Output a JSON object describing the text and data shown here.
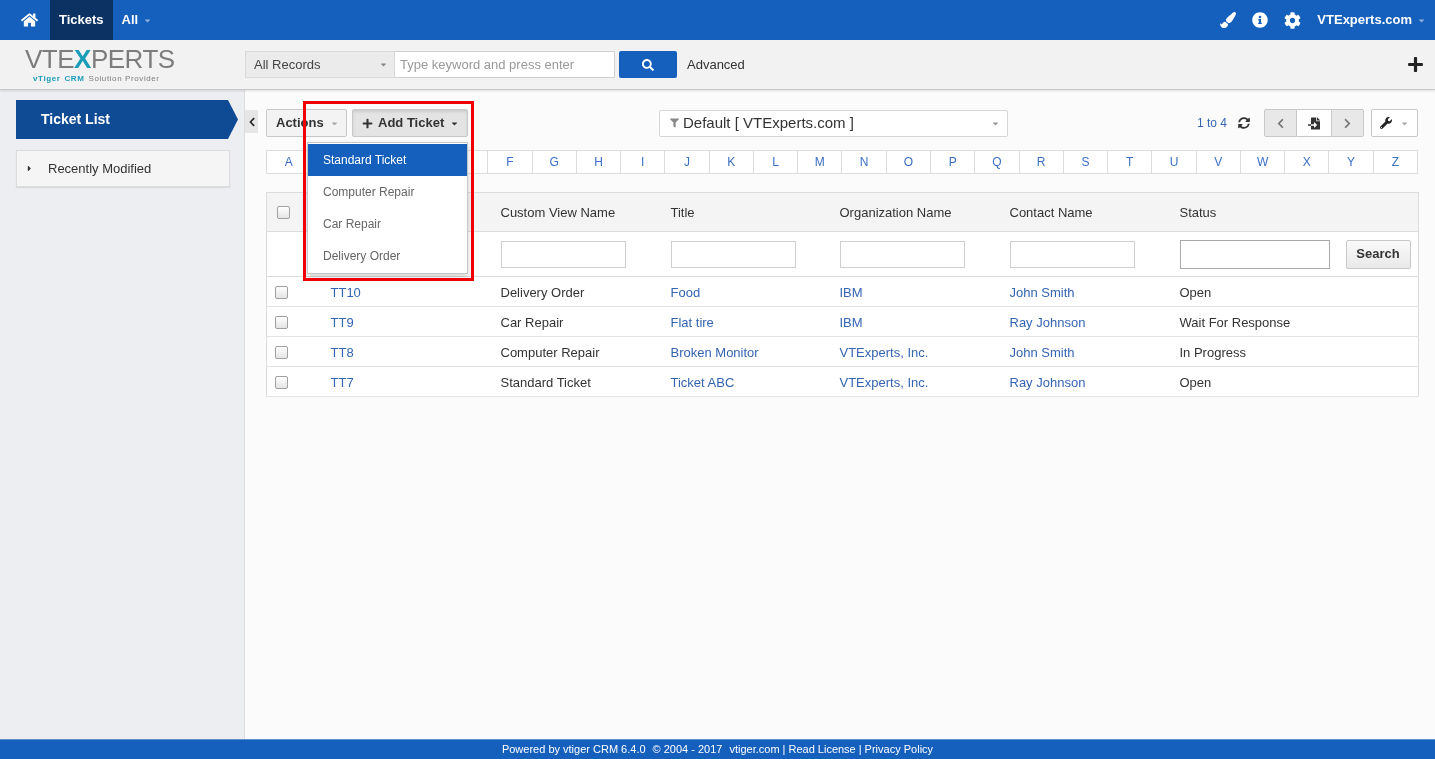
{
  "top_nav": {
    "tabs": [
      {
        "label": "Tickets",
        "kind": "module",
        "selected": true
      },
      {
        "label": "All",
        "kind": "menu",
        "selected": false
      }
    ],
    "user_menu": {
      "label": "VTExperts.com"
    }
  },
  "header": {
    "logo": {
      "wordmark": [
        {
          "text": "VTE",
          "color": "#7d7d7d"
        },
        {
          "text": "X",
          "color": "#1b9cb8"
        },
        {
          "text": "PERTS",
          "color": "#7d7d7d"
        }
      ],
      "tagline": [
        {
          "text": "vTiger",
          "accent": true
        },
        {
          "text": "CRM",
          "accent": true
        },
        {
          "text": "Solution Provider",
          "accent": false
        }
      ]
    },
    "search": {
      "scope": "All Records",
      "placeholder": "Type keyword and press enter"
    },
    "advanced_link": "Advanced"
  },
  "sidebar": {
    "title": "Ticket List",
    "sections": [
      {
        "label": "Recently Modified",
        "expanded": false
      }
    ]
  },
  "toolbar": {
    "actions": {
      "label": "Actions"
    },
    "add_ticket": {
      "label": "Add Ticket",
      "expanded": true,
      "highlighted": true,
      "menu": [
        {
          "label": "Standard Ticket",
          "selected": true
        },
        {
          "label": "Computer Repair",
          "selected": false
        },
        {
          "label": "Car Repair",
          "selected": false
        },
        {
          "label": "Delivery Order",
          "selected": false
        }
      ]
    },
    "filter": {
      "value": "Default [ VTExperts.com ]"
    },
    "pagination": {
      "range": "1 to 4",
      "previous": {
        "disabled": true
      },
      "next": {
        "disabled": true
      }
    }
  },
  "alphabet": {
    "letters_before_menu": [
      "A"
    ],
    "letters_after_menu": [
      "F",
      "G",
      "H",
      "I",
      "J",
      "K",
      "L",
      "M",
      "N",
      "O",
      "P",
      "Q",
      "R",
      "S",
      "T",
      "U",
      "V",
      "W",
      "X",
      "Y",
      "Z"
    ]
  },
  "table": {
    "header_checkbox": {
      "checked": false
    },
    "columns": [
      {
        "kind": "link"
      },
      {
        "label": "Custom View Name",
        "kind": "text",
        "filter": true
      },
      {
        "label": "Title",
        "kind": "link",
        "filter": true
      },
      {
        "label": "Organization Name",
        "kind": "link",
        "filter": true
      },
      {
        "label": "Contact Name",
        "kind": "link",
        "filter": true
      },
      {
        "label": "Status",
        "kind": "text",
        "filter": true
      }
    ],
    "search_button": "Search",
    "rows": [
      {
        "checked": false,
        "cells": [
          "TT10",
          "Delivery Order",
          "Food",
          "IBM",
          "John Smith",
          "Open"
        ]
      },
      {
        "checked": false,
        "cells": [
          "TT9",
          "Car Repair",
          "Flat tire",
          "IBM",
          "Ray Johnson",
          "Wait For Response"
        ]
      },
      {
        "checked": false,
        "cells": [
          "TT8",
          "Computer Repair",
          "Broken Monitor",
          "VTExperts, Inc.",
          "John Smith",
          "In Progress"
        ]
      },
      {
        "checked": false,
        "cells": [
          "TT7",
          "Standard Ticket",
          "Ticket ABC",
          "VTExperts, Inc.",
          "Ray Johnson",
          "Open"
        ]
      }
    ]
  },
  "footer": {
    "powered_by": "Powered by vtiger CRM 6.4.0",
    "copyright": "© 2004 - 2017",
    "links": [
      "vtiger.com",
      "Read License",
      "Privacy Policy"
    ],
    "separator": "|"
  }
}
